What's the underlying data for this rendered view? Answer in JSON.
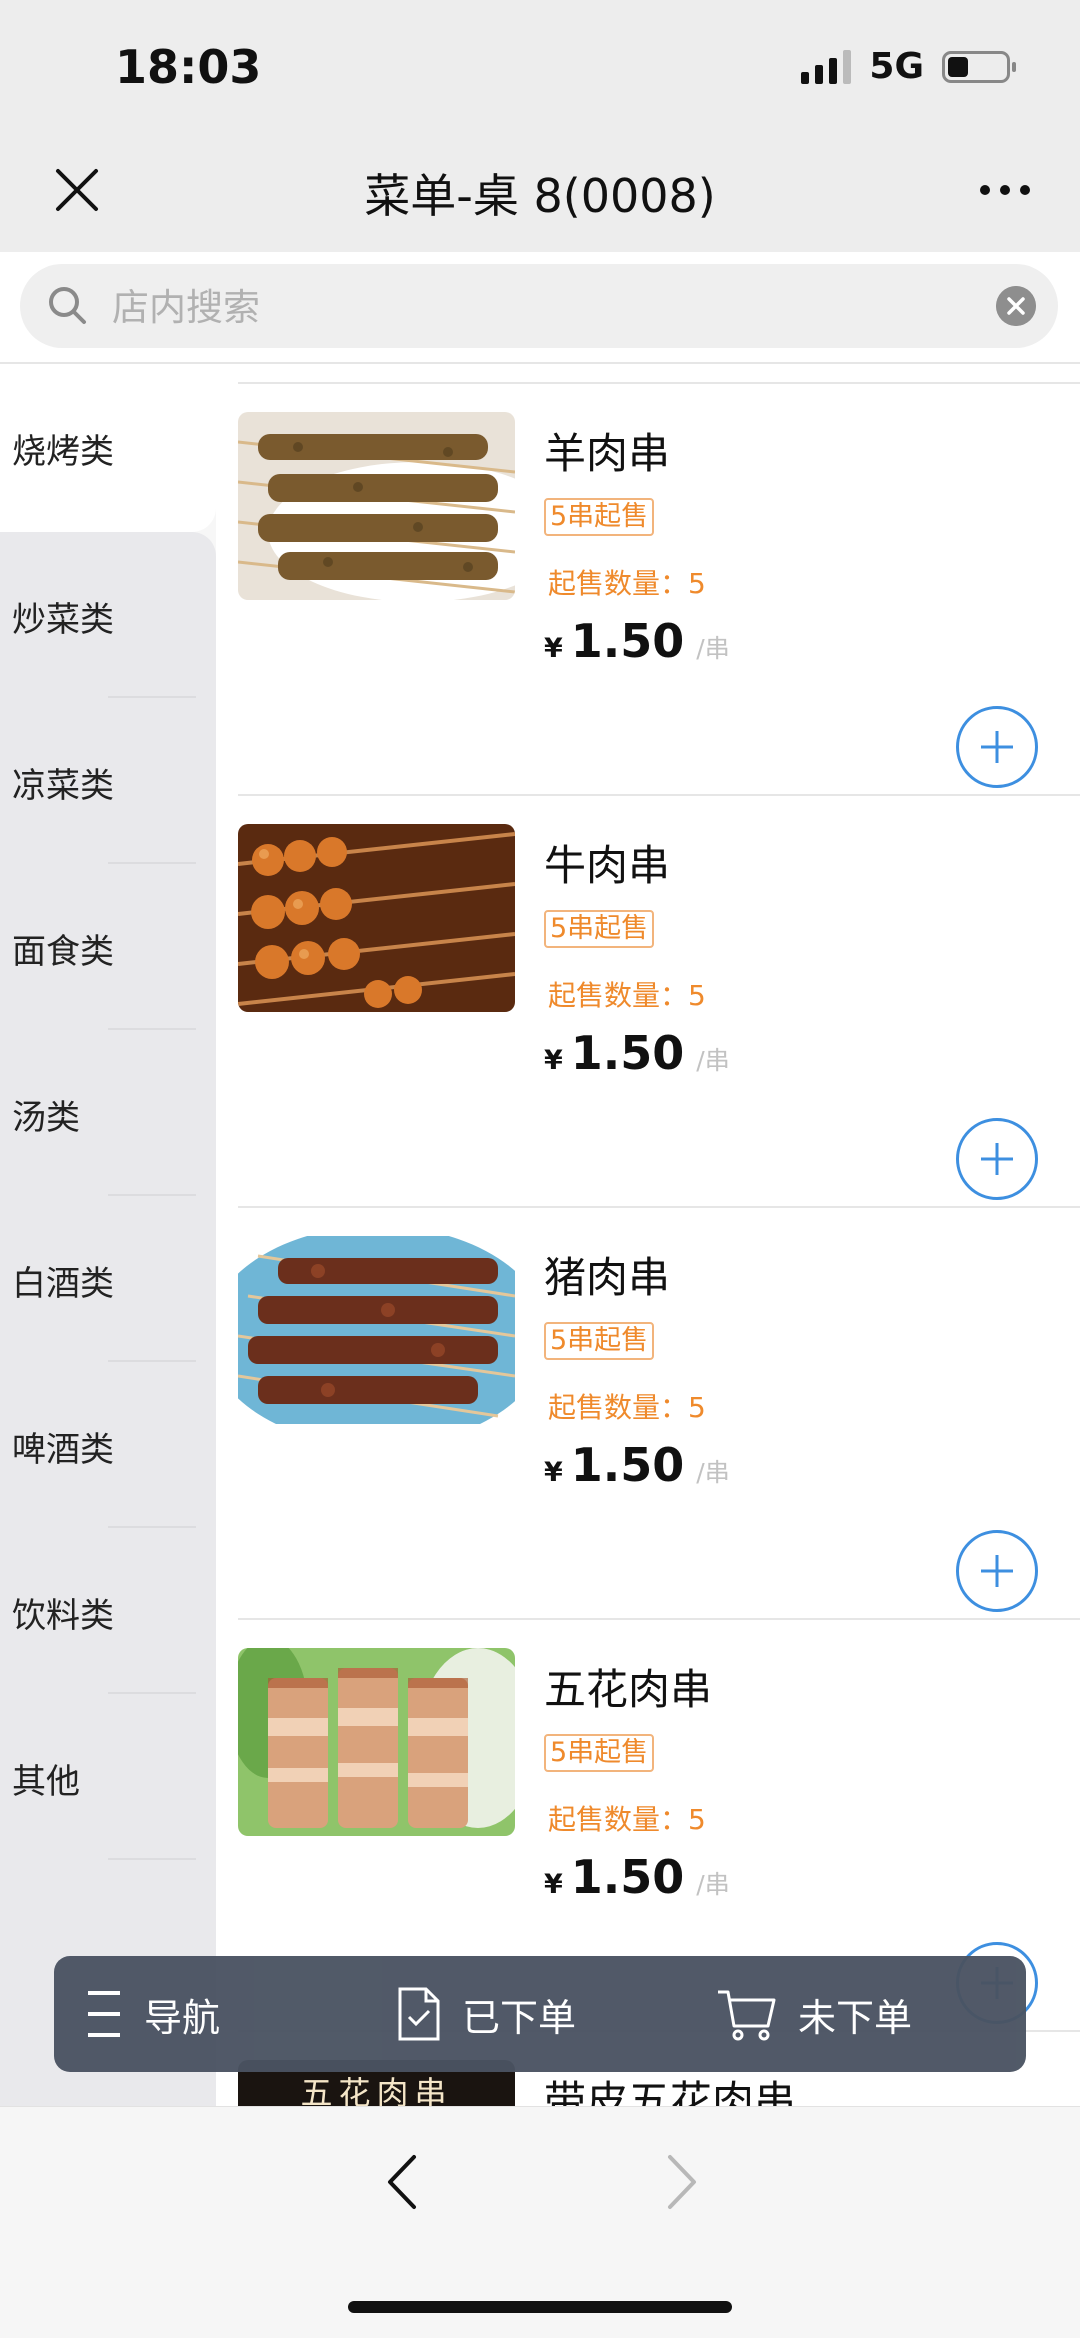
{
  "status_bar": {
    "time": "18:03",
    "network": "5G",
    "battery_percent": 35
  },
  "nav": {
    "title": "菜单-桌 8(0008)"
  },
  "search": {
    "placeholder": "店内搜索",
    "value": ""
  },
  "sidebar": {
    "items": [
      {
        "label": "烧烤类"
      },
      {
        "label": "炒菜类"
      },
      {
        "label": "凉菜类"
      },
      {
        "label": "面食类"
      },
      {
        "label": "汤类"
      },
      {
        "label": "白酒类"
      },
      {
        "label": "啤酒类"
      },
      {
        "label": "饮料类"
      },
      {
        "label": "其他"
      }
    ],
    "active_index": 0
  },
  "menu": {
    "items": [
      {
        "name": "羊肉串",
        "tag": "5串起售",
        "min_qty": "起售数量：5",
        "currency": "¥",
        "price": "1.50",
        "unit": "/串"
      },
      {
        "name": "牛肉串",
        "tag": "5串起售",
        "min_qty": "起售数量：5",
        "currency": "¥",
        "price": "1.50",
        "unit": "/串"
      },
      {
        "name": "猪肉串",
        "tag": "5串起售",
        "min_qty": "起售数量：5",
        "currency": "¥",
        "price": "1.50",
        "unit": "/串"
      },
      {
        "name": "五花肉串",
        "tag": "5串起售",
        "min_qty": "起售数量：5",
        "currency": "¥",
        "price": "1.50",
        "unit": "/串"
      },
      {
        "name": "带皮五花肉串",
        "thumb_caption": "五花肉串"
      }
    ]
  },
  "float_bar": {
    "nav_label": "导航",
    "ordered_label": "已下单",
    "unordered_label": "未下单"
  },
  "colors": {
    "accent_blue": "#3d8fe0",
    "tag_orange": "#ef8a2c",
    "float_bar_bg": "#4a5362"
  }
}
